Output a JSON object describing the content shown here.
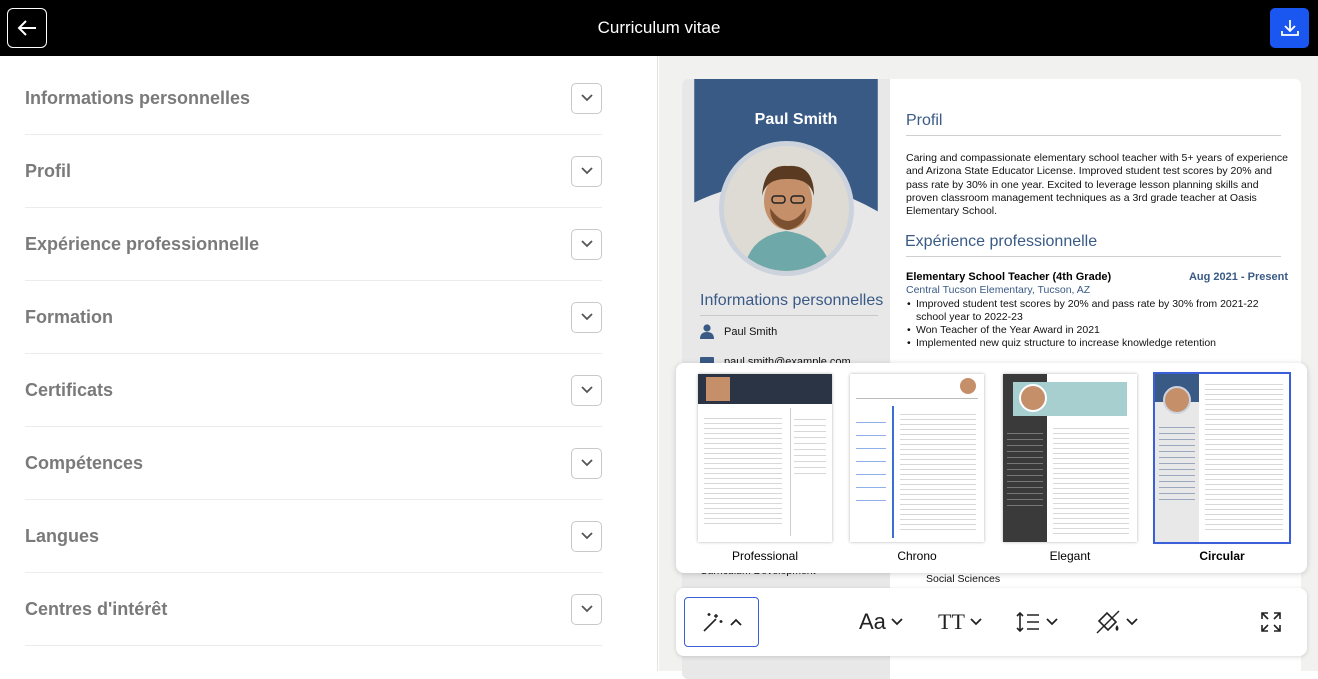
{
  "header": {
    "title": "Curriculum vitae"
  },
  "sections": [
    {
      "label": "Informations personnelles"
    },
    {
      "label": "Profil"
    },
    {
      "label": "Expérience professionnelle"
    },
    {
      "label": "Formation"
    },
    {
      "label": "Certificats"
    },
    {
      "label": "Compétences"
    },
    {
      "label": "Langues"
    },
    {
      "label": "Centres d'intérêt"
    }
  ],
  "cv": {
    "name": "Paul Smith",
    "personal_heading": "Informations personnelles",
    "personal_name": "Paul Smith",
    "personal_email": "paul.smith@example.com",
    "profile_heading": "Profil",
    "profile_text": "Caring and compassionate elementary school teacher with 5+ years of experience and Arizona State Educator License. Improved student test scores by 20% and pass rate by 30% in one year. Excited to leverage lesson planning skills and proven classroom management techniques as a 3rd grade teacher at Oasis Elementary School.",
    "experience_heading": "Expérience professionnelle",
    "job_title": "Elementary School Teacher (4th Grade)",
    "job_date": "Aug 2021 - Present",
    "job_company": "Central Tucson Elementary, Tucson, AZ",
    "bullets": [
      "Improved student test scores by 20% and pass rate by 30% from 2021-22 school year to 2022-23",
      "Won Teacher of the Year Award in 2021",
      "Implemented new quiz structure to increase knowledge retention"
    ],
    "peek_left": "Curriculum Development",
    "peek_right": "Social Sciences"
  },
  "templates": [
    {
      "name": "Professional",
      "selected": false
    },
    {
      "name": "Chrono",
      "selected": false
    },
    {
      "name": "Elegant",
      "selected": false
    },
    {
      "name": "Circular",
      "selected": true
    }
  ],
  "toolbar": {
    "font_label": "Aa",
    "size_label": "TT"
  },
  "colors": {
    "accent": "#3a5a86",
    "primary_button": "#1a56f0",
    "topbar": "#000000"
  }
}
